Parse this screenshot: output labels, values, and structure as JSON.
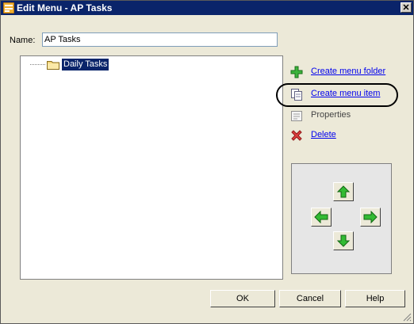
{
  "window": {
    "title": "Edit Menu - AP Tasks",
    "close_glyph": "✕"
  },
  "form": {
    "name_label": "Name:",
    "name_value": "AP Tasks"
  },
  "tree": {
    "items": [
      {
        "label": "Daily Tasks",
        "icon": "folder-icon",
        "selected": true
      }
    ]
  },
  "actions": [
    {
      "label": "Create menu folder",
      "icon": "plus-icon",
      "enabled": true
    },
    {
      "label": "Create menu item",
      "icon": "new-item-icon",
      "enabled": true,
      "highlighted": true
    },
    {
      "label": "Properties",
      "icon": "properties-icon",
      "enabled": false
    },
    {
      "label": "Delete",
      "icon": "delete-icon",
      "enabled": true
    }
  ],
  "move_buttons": [
    "up",
    "left",
    "right",
    "down"
  ],
  "buttons": {
    "ok": "OK",
    "cancel": "Cancel",
    "help": "Help"
  },
  "colors": {
    "titlebar": "#0a246a",
    "dialog": "#ece9d8",
    "link": "#0000ee",
    "arrow_green": "#22aa22",
    "selection": "#0a246a"
  }
}
